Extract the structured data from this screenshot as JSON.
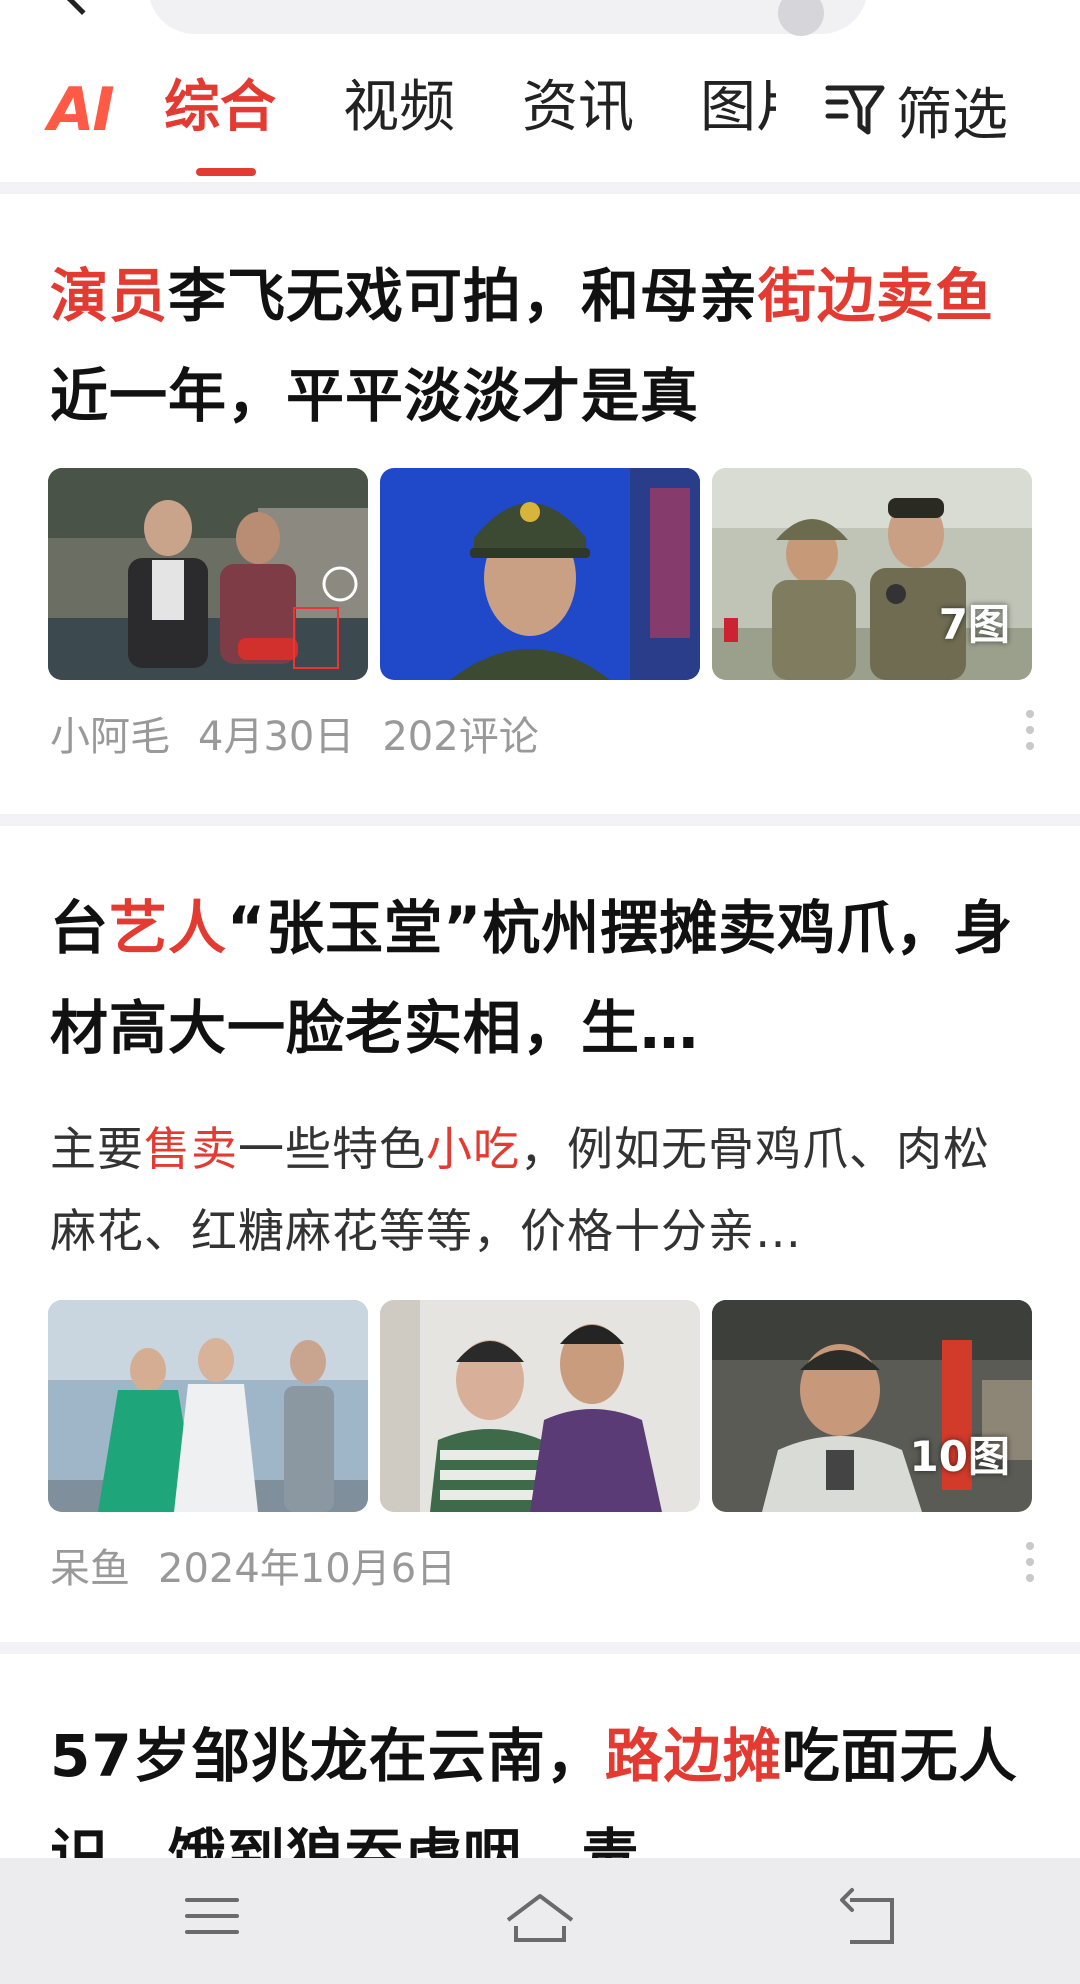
{
  "tabs": {
    "ai": "AI",
    "items": [
      "综合",
      "视频",
      "资讯",
      "图片"
    ],
    "active_index": 0,
    "filter_label": "筛选"
  },
  "articles": [
    {
      "headline_parts": [
        {
          "text": "演员",
          "hl": true
        },
        {
          "text": "李飞无戏可拍，和母亲",
          "hl": false
        },
        {
          "text": "街边卖鱼",
          "hl": true
        },
        {
          "text": "近一年，平平淡淡才是真",
          "hl": false
        }
      ],
      "image_count": "7图",
      "author": "小阿毛",
      "date": "4月30日",
      "comments": "202评论"
    },
    {
      "headline_parts": [
        {
          "text": "台",
          "hl": false
        },
        {
          "text": "艺人",
          "hl": true
        },
        {
          "text": "“张玉堂”杭州摆摊卖鸡爪，身材高大一脸老实相，生…",
          "hl": false
        }
      ],
      "snippet_parts": [
        {
          "text": "主要",
          "hl": false
        },
        {
          "text": "售卖",
          "hl": true
        },
        {
          "text": "一些特色",
          "hl": false
        },
        {
          "text": "小吃",
          "hl": true
        },
        {
          "text": "，例如无骨鸡爪、肉松麻花、红糖麻花等等，价格十分亲…",
          "hl": false
        }
      ],
      "image_count": "10图",
      "author": "呆鱼",
      "date": "2024年10月6日"
    },
    {
      "headline_parts": [
        {
          "text": "57岁邹兆龙在云南，",
          "hl": false
        },
        {
          "text": "路边摊",
          "hl": true
        },
        {
          "text": "吃面无人识，饿到狼吞虎咽，毒",
          "hl": false
        }
      ]
    }
  ],
  "icons": {
    "back": "chevron-left-icon",
    "filter": "filter-funnel-icon",
    "more": "more-vertical-icon",
    "nav_menu": "menu-icon",
    "nav_home": "home-icon",
    "nav_back": "back-icon"
  },
  "colors": {
    "accent": "#e33a32",
    "ai_gradient": "#ff5a45",
    "meta_text": "#999999",
    "nav_bg": "#ececee"
  }
}
